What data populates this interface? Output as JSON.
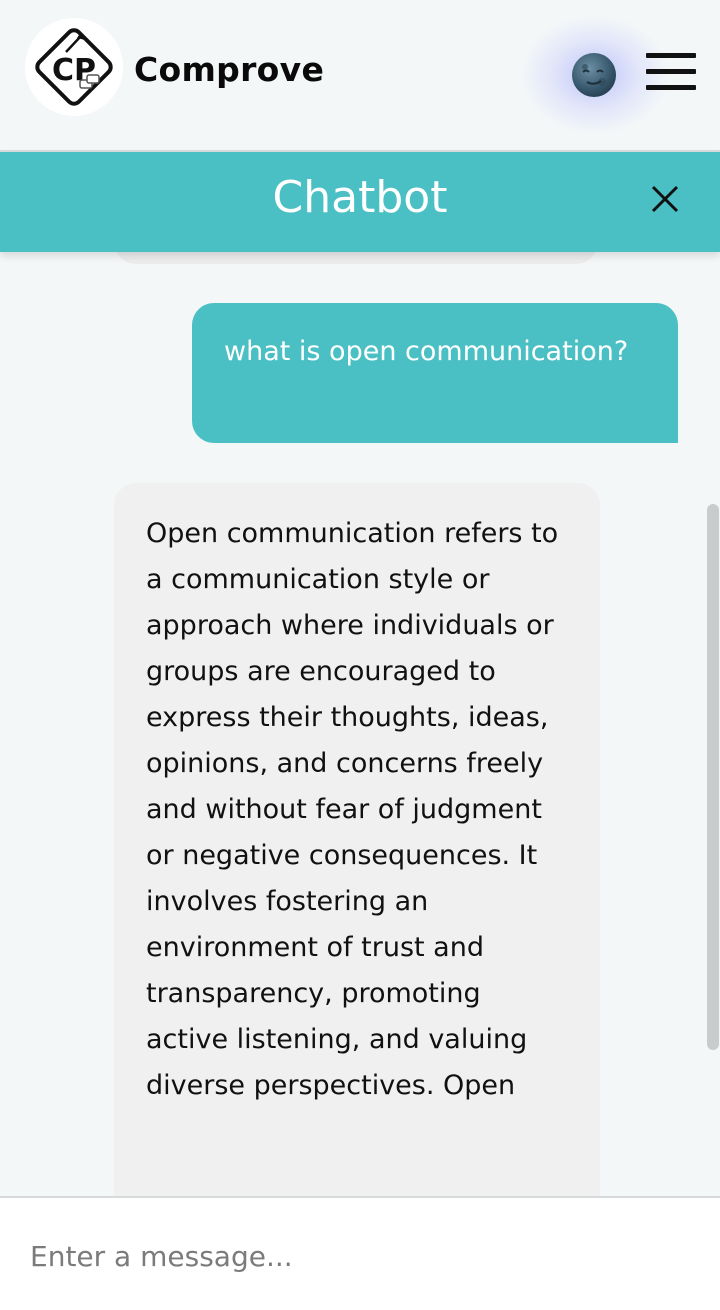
{
  "header": {
    "logo_text": "CP",
    "brand": "Comprove",
    "theme_toggle_icon": "moon-icon",
    "menu_icon": "hamburger-icon"
  },
  "chat": {
    "title": "Chatbot",
    "close_icon": "close-icon",
    "messages": [
      {
        "role": "user",
        "text": "what is open communication?"
      },
      {
        "role": "bot",
        "text": "Open communication refers to a communication style or approach where individuals or groups are encouraged to express their thoughts, ideas, opinions, and concerns freely and without fear of judgment or negative consequences. It involves fostering an environment of trust and transparency, promoting active listening, and valuing diverse perspectives. Open"
      }
    ]
  },
  "input": {
    "placeholder": "Enter a message...",
    "value": ""
  },
  "colors": {
    "accent": "#4bc0c4",
    "bot_bubble": "#f0f0f0",
    "background": "#f4f7f8"
  }
}
